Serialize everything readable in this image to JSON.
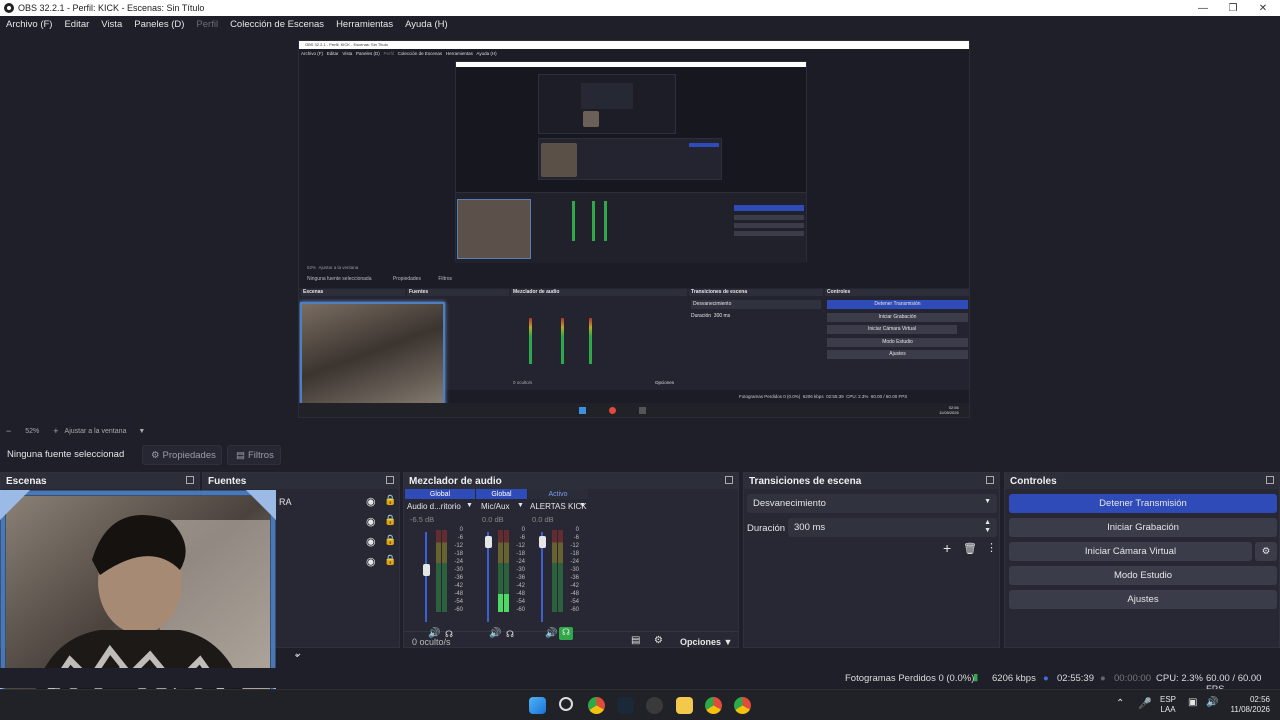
{
  "window": {
    "title": "OBS 32.2.1 - Perfil: KICK - Escenas: Sin Título"
  },
  "menu": [
    "Archivo (F)",
    "Editar",
    "Vista",
    "Paneles (D)",
    "Perfil",
    "Colección de Escenas",
    "Herramientas",
    "Ayuda (H)"
  ],
  "zoom": {
    "value": "52%",
    "fit_label": "Ajustar a la ventana"
  },
  "source_toolbar": {
    "selected": "Ninguna fuente seleccionad",
    "properties": "Propiedades",
    "filters": "Filtros"
  },
  "docks": {
    "scenes": "Escenas",
    "sources": "Fuentes",
    "mixer": "Mezclador de audio",
    "transitions": "Transiciones de escena",
    "controls": "Controles"
  },
  "mixer": {
    "channels": [
      {
        "tab": "Global",
        "name": "Audio d...ritorio",
        "db": "-6.5 dB",
        "level": 0.0,
        "fader": 0.62,
        "tab_color": "#2f4bb8"
      },
      {
        "tab": "Global",
        "name": "Mic/Aux",
        "db": "0.0 dB",
        "level": 0.22,
        "fader": 0.95,
        "tab_color": "#2f4bb8"
      },
      {
        "tab": "Activo",
        "name": "ALERTAS KICK",
        "db": "0.0 dB",
        "level": 0.0,
        "fader": 0.95,
        "tab_color": "#2a2c37"
      }
    ],
    "scale": [
      "0",
      "-6",
      "-12",
      "-18",
      "-24",
      "-30",
      "-36",
      "-42",
      "-48",
      "-54",
      "-60"
    ],
    "hidden_count": "0 oculto/s",
    "options": "Opciones"
  },
  "transitions": {
    "type": "Desvanecimiento",
    "duration_label": "Duración",
    "duration_value": "300 ms"
  },
  "controls": {
    "stop_stream": "Detener Transmisión",
    "start_recording": "Iniciar Grabación",
    "start_virtual_cam": "Iniciar Cámara Virtual",
    "studio_mode": "Modo Estudio",
    "settings": "Ajustes"
  },
  "sources": {
    "partial_label": "RA"
  },
  "status": {
    "dropped": "Fotogramas Perdidos 0 (0.0%)",
    "bitrate": "6206 kbps",
    "stream_time": "02:55:39",
    "rec_time": "00:00:00",
    "cpu": "CPU: 2.3%",
    "fps": "60.00 / 60.00 FPS"
  },
  "taskbar": {
    "lang_top": "ESP",
    "lang_bottom": "LAA",
    "time": "02:56",
    "date": "11/08/2026"
  },
  "nested_preview": {
    "title": "OBS 32.2.1 - Perfil: KICK - Escenas: Sin Título",
    "menu": [
      "Archivo (F)",
      "Editar",
      "Vista",
      "Paneles (D)",
      "Perfil",
      "Colección de Escenas",
      "Herramientas",
      "Ayuda (H)"
    ],
    "selected": "Ninguna fuente seleccionada",
    "properties": "Propiedades",
    "filters": "Filtros",
    "scenes": "Escenas",
    "sources": "Fuentes",
    "mixer": "Mezclador de audio",
    "transitions": "Transiciones de escena",
    "controls": "Controles",
    "transition_type": "Desvanecimiento",
    "duration_label": "Duración",
    "duration_value": "300 ms",
    "stop_stream": "Detener Transmisión",
    "start_recording": "Iniciar Grabación",
    "start_virtual_cam": "Iniciar Cámara Virtual",
    "studio_mode": "Modo Estudio",
    "settings": "Ajustes",
    "status": "Fotogramas Perdidos 0 (0.0%)",
    "bitrate": "6206 kbps",
    "stream_time": "02:55:39",
    "cpu": "CPU: 2.3%",
    "fps": "60.00 / 60.00 FPS",
    "zoom": "52%",
    "fit": "Ajustar a la ventana",
    "time": "02:56",
    "date": "11/08/2026",
    "hidden": "0 oculto/s",
    "options": "Opciones"
  },
  "colors": {
    "accent": "#2f4bb8",
    "meter_green": "#2fa84a",
    "meter_yellow": "#b8a72c",
    "meter_red": "#a9302f",
    "bg": "#1e1f29"
  }
}
